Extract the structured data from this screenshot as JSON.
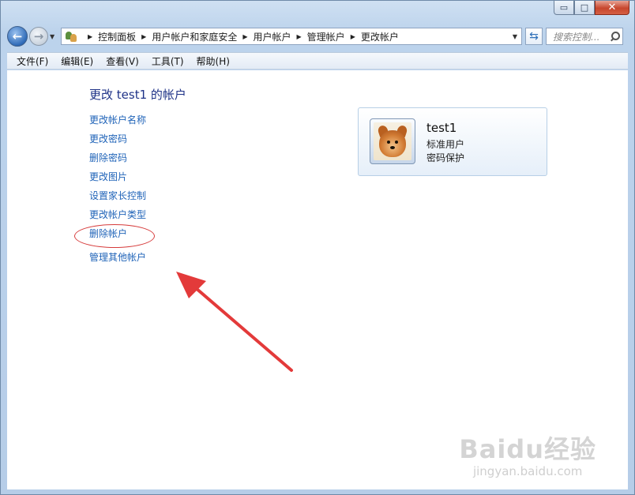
{
  "caption": {
    "minimize": "▭",
    "maximize": "□",
    "close": "✕"
  },
  "nav": {
    "back": "←",
    "forward": "→"
  },
  "breadcrumb": [
    "控制面板",
    "用户帐户和家庭安全",
    "用户帐户",
    "管理帐户",
    "更改帐户"
  ],
  "search": {
    "placeholder": "搜索控制..."
  },
  "menu": [
    "文件(F)",
    "编辑(E)",
    "查看(V)",
    "工具(T)",
    "帮助(H)"
  ],
  "page": {
    "title": "更改 test1 的帐户"
  },
  "tasks": [
    "更改帐户名称",
    "更改密码",
    "删除密码",
    "更改图片",
    "设置家长控制",
    "更改帐户类型",
    "删除帐户",
    "管理其他帐户"
  ],
  "account": {
    "name": "test1",
    "type": "标准用户",
    "password_status": "密码保护"
  },
  "colors": {
    "link": "#1f63b8",
    "title": "#1e3287",
    "annotation": "#e33a3a"
  },
  "watermark": {
    "logo": "Baidu经验",
    "url": "jingyan.baidu.com"
  }
}
